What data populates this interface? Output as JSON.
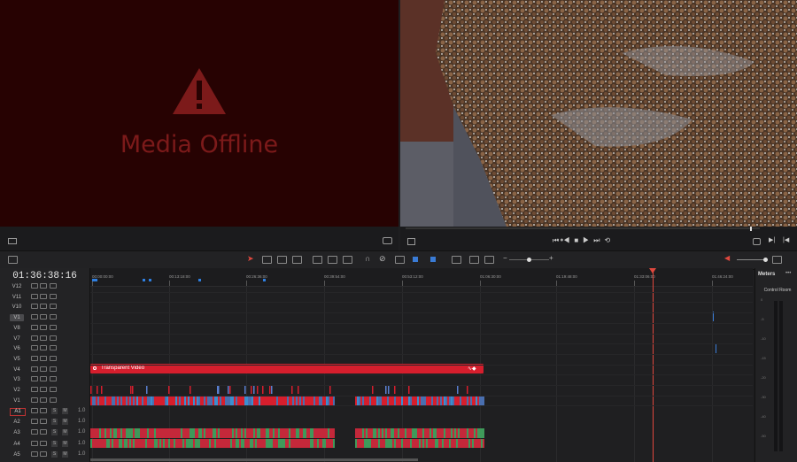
{
  "source_viewer": {
    "offline_message": "Media Offline"
  },
  "timeline": {
    "timecode": "01:36:38:16",
    "ruler_ticks": [
      "00:00:00:00",
      "00:13:18:00",
      "00:26:36:00",
      "00:39:54:00",
      "00:53:12:00",
      "01:06:30:00",
      "01:19:48:00",
      "01:33:06:00",
      "01:46:24:00"
    ],
    "video_tracks": [
      "V12",
      "V11",
      "V10",
      "V1",
      "V8",
      "V7",
      "V6",
      "V5",
      "V4",
      "V3",
      "V2",
      "V1"
    ],
    "audio_tracks": [
      {
        "label": "A1",
        "volume": "1.0"
      },
      {
        "label": "A2",
        "volume": "1.0"
      },
      {
        "label": "A3",
        "volume": "1.0"
      },
      {
        "label": "A4",
        "volume": "1.0"
      },
      {
        "label": "A5",
        "volume": "1.0"
      }
    ],
    "clips": {
      "transparent_video": "Transparent Video"
    },
    "clip_color": "#d61e2d"
  },
  "meters": {
    "title": "Meters",
    "control_room": "Control Room",
    "scale": [
      "0",
      "-5",
      "-10",
      "-15",
      "-20",
      "-30",
      "-40",
      "-50"
    ]
  },
  "icons": {
    "warning": "warning-triangle-icon",
    "playhead": "playhead-marker-icon"
  },
  "accent": "#e0483e"
}
